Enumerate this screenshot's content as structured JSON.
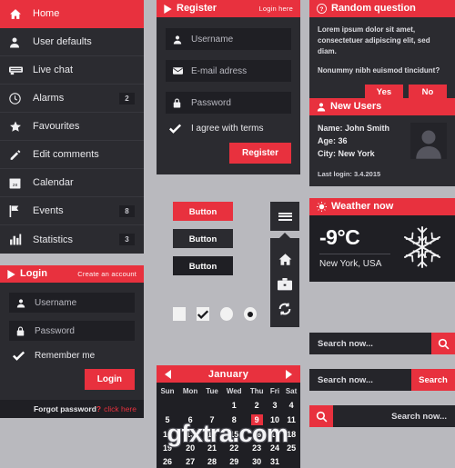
{
  "theme": {
    "accent": "#e8313e",
    "panel_dark": "#2b2b30",
    "panel_darker": "#1f1f24",
    "page_bg": "#b9b9be",
    "text_light": "#e9e9ec"
  },
  "sidebar": {
    "items": [
      {
        "label": "Home",
        "icon": "home-icon",
        "badge": "",
        "active": true
      },
      {
        "label": "User defaults",
        "icon": "user-icon",
        "badge": "",
        "active": false
      },
      {
        "label": "Live chat",
        "icon": "chat-icon",
        "badge": "",
        "active": false
      },
      {
        "label": "Alarms",
        "icon": "clock-icon",
        "badge": "2",
        "active": false
      },
      {
        "label": "Favourites",
        "icon": "star-icon",
        "badge": "",
        "active": false
      },
      {
        "label": "Edit comments",
        "icon": "pencil-icon",
        "badge": "",
        "active": false
      },
      {
        "label": "Calendar",
        "icon": "calendar-icon",
        "badge": "",
        "active": false
      },
      {
        "label": "Events",
        "icon": "flag-icon",
        "badge": "8",
        "active": false
      },
      {
        "label": "Statistics",
        "icon": "bar-chart-icon",
        "badge": "3",
        "active": false
      }
    ]
  },
  "login": {
    "title": "Login",
    "link": "Create an account",
    "username_placeholder": "Username",
    "password_placeholder": "Password",
    "remember_label": "Remember me",
    "submit_label": "Login",
    "footer_text": "Forgot password",
    "footer_mark": "?",
    "footer_link": "click here"
  },
  "register": {
    "title": "Register",
    "link": "Login here",
    "username_placeholder": "Username",
    "email_placeholder": "E-mail adress",
    "password_placeholder": "Password",
    "terms_label": "I agree with terms",
    "submit_label": "Register"
  },
  "buttons": {
    "primary_label": "Button",
    "secondary_label": "Button",
    "tertiary_label": "Button"
  },
  "toggles": {
    "checkbox_unchecked": "unchecked",
    "checkbox_checked": "checked",
    "radio_unselected": "unselected",
    "radio_selected": "selected"
  },
  "icon_menu": {
    "toggle": "hamburger-icon",
    "items": [
      "home-icon",
      "briefcase-icon",
      "refresh-icon"
    ]
  },
  "calendar": {
    "month": "January",
    "prev": "prev-month",
    "next": "next-month",
    "weekdays": [
      "Sun",
      "Mon",
      "Tue",
      "Wed",
      "Thu",
      "Fri",
      "Sat"
    ],
    "weeks": [
      [
        "",
        "",
        "",
        "1",
        "2",
        "3",
        "4"
      ],
      [
        "5",
        "6",
        "7",
        "8",
        "9",
        "10",
        "11"
      ],
      [
        "12",
        "13",
        "14",
        "15",
        "16",
        "17",
        "18"
      ],
      [
        "19",
        "20",
        "21",
        "22",
        "23",
        "24",
        "25"
      ],
      [
        "26",
        "27",
        "28",
        "29",
        "30",
        "31",
        ""
      ]
    ],
    "selected_day": "9"
  },
  "question": {
    "title": "Random question",
    "body_1": "Lorem ipsum dolor sit amet, consectetuer adipiscing elit, sed diam.",
    "body_2": "Nonummy nibh euismod tincidunt?",
    "yes_label": "Yes",
    "no_label": "No"
  },
  "new_users": {
    "title": "New Users",
    "name": "Name: John Smith",
    "age": "Age: 36",
    "city": "City: New York",
    "last_login": "Last login: 3.4.2015"
  },
  "weather": {
    "title": "Weather now",
    "temperature": "-9°C",
    "location": "New York, USA",
    "icon": "snowflake-icon"
  },
  "search": {
    "bar1_placeholder": "Search now...",
    "bar2_placeholder": "Search now...",
    "bar2_button": "Search",
    "bar3_placeholder": "Search now..."
  },
  "watermark": {
    "text": "gfxtra.com"
  }
}
